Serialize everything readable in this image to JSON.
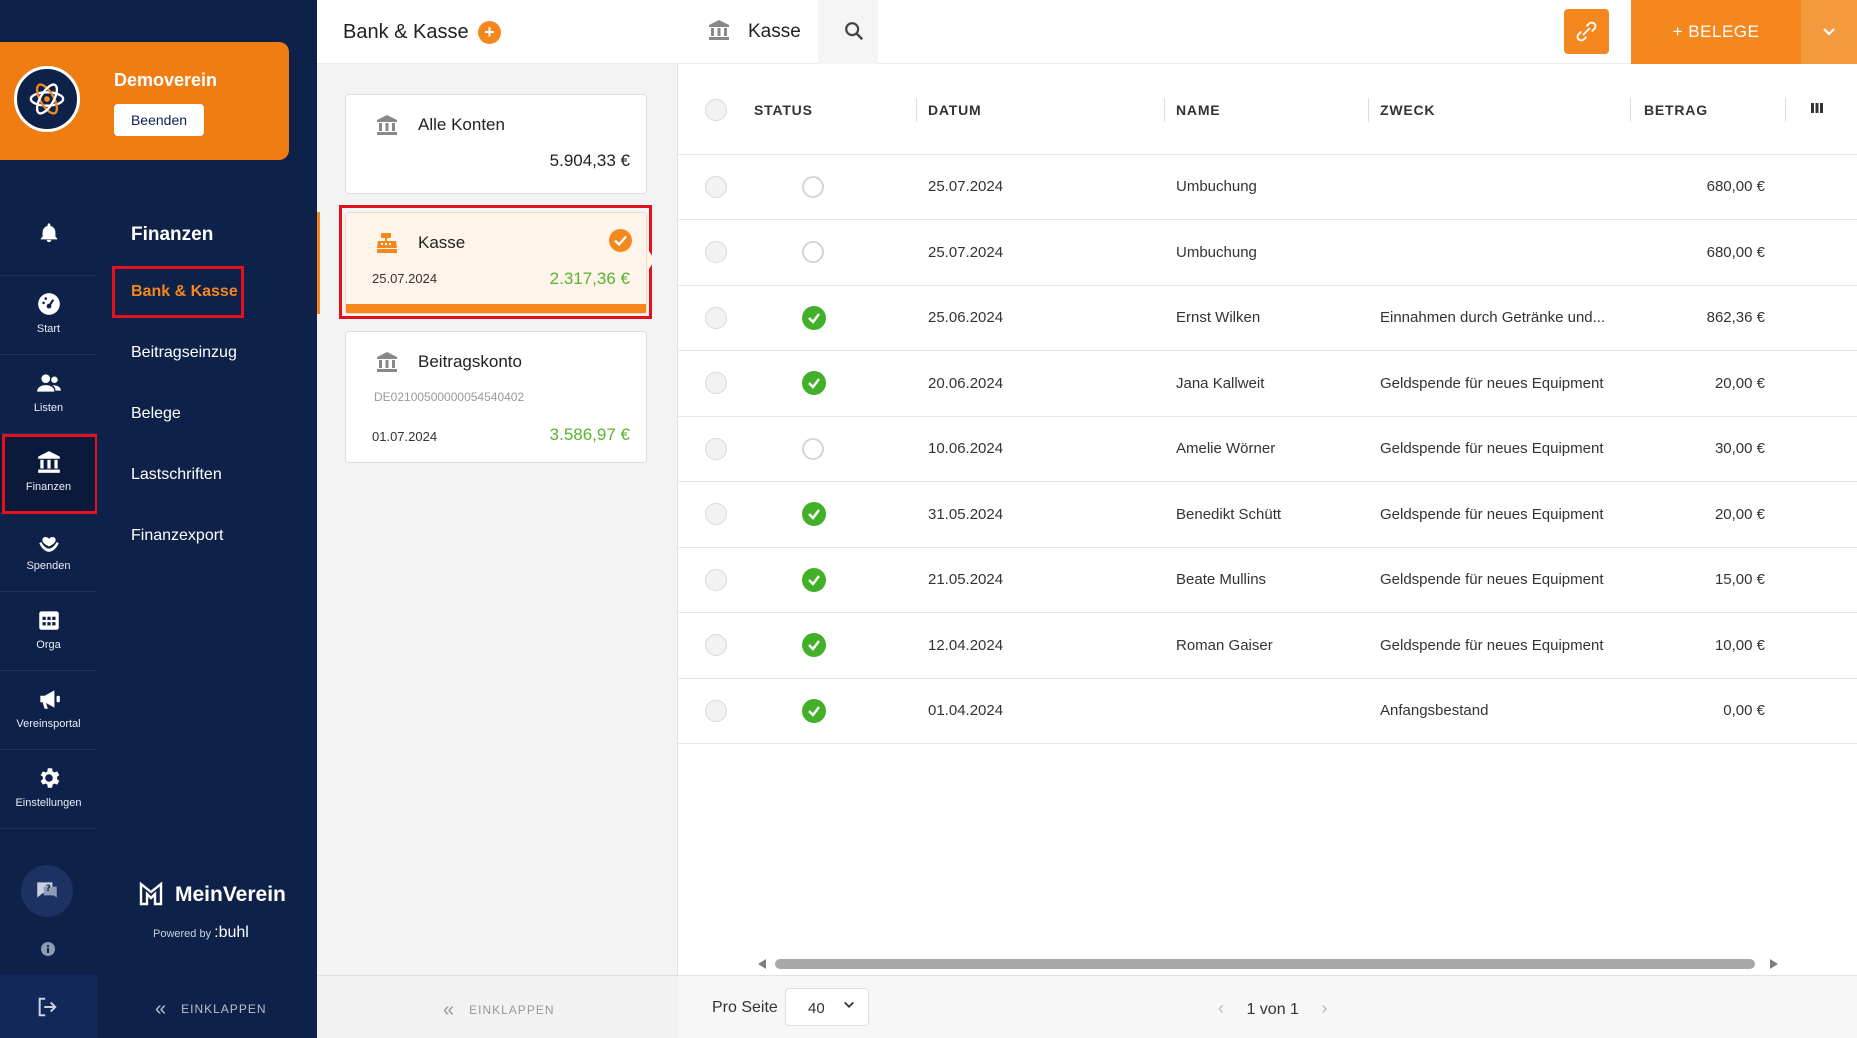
{
  "org": {
    "name": "Demoverein",
    "end_button": "Beenden"
  },
  "rail": {
    "items": [
      {
        "label": "Start",
        "icon": "dashboard-icon"
      },
      {
        "label": "Listen",
        "icon": "users-icon"
      },
      {
        "label": "Finanzen",
        "icon": "bank-icon"
      },
      {
        "label": "Spenden",
        "icon": "donation-icon"
      },
      {
        "label": "Orga",
        "icon": "calendar-icon"
      },
      {
        "label": "Vereinsportal",
        "icon": "megaphone-icon"
      },
      {
        "label": "Einstellungen",
        "icon": "gear-icon"
      }
    ]
  },
  "subnav": {
    "title": "Finanzen",
    "items": [
      {
        "label": "Bank & Kasse",
        "active": true
      },
      {
        "label": "Beitragseinzug"
      },
      {
        "label": "Belege"
      },
      {
        "label": "Lastschriften"
      },
      {
        "label": "Finanzexport"
      }
    ],
    "brand": {
      "name": "MeinVerein",
      "powered": "Powered by",
      "powered_brand": ":buhl"
    },
    "collapse_label": "EINKLAPPEN"
  },
  "accounts": {
    "title": "Bank & Kasse",
    "add_label": "+",
    "cards": [
      {
        "name": "Alle Konten",
        "amount": "5.904,33 €"
      },
      {
        "name": "Kasse",
        "date": "25.07.2024",
        "amount": "2.317,36 €"
      },
      {
        "name": "Beitragskonto",
        "iban": "DE02100500000054540402",
        "date": "01.07.2024",
        "amount": "3.586,97 €"
      }
    ],
    "collapse_label": "EINKLAPPEN"
  },
  "main": {
    "title": "Kasse",
    "belege_button": "+ BELEGE",
    "columns": {
      "status": "STATUS",
      "date": "DATUM",
      "name": "NAME",
      "purpose": "ZWECK",
      "amount": "BETRAG"
    },
    "rows": [
      {
        "status": "open",
        "date": "25.07.2024",
        "name": "Umbuchung",
        "purpose": "",
        "amount": "680,00 €"
      },
      {
        "status": "open",
        "date": "25.07.2024",
        "name": "Umbuchung",
        "purpose": "",
        "amount": "680,00 €"
      },
      {
        "status": "done",
        "date": "25.06.2024",
        "name": "Ernst Wilken",
        "purpose": "Einnahmen durch Getränke und...",
        "amount": "862,36 €"
      },
      {
        "status": "done",
        "date": "20.06.2024",
        "name": "Jana Kallweit",
        "purpose": "Geldspende für neues Equipment",
        "amount": "20,00 €"
      },
      {
        "status": "open",
        "date": "10.06.2024",
        "name": "Amelie Wörner",
        "purpose": "Geldspende für neues Equipment",
        "amount": "30,00 €"
      },
      {
        "status": "done",
        "date": "31.05.2024",
        "name": "Benedikt Schütt",
        "purpose": "Geldspende für neues Equipment",
        "amount": "20,00 €"
      },
      {
        "status": "done",
        "date": "21.05.2024",
        "name": "Beate Mullins",
        "purpose": "Geldspende für neues Equipment",
        "amount": "15,00 €"
      },
      {
        "status": "done",
        "date": "12.04.2024",
        "name": "Roman Gaiser",
        "purpose": "Geldspende für neues Equipment",
        "amount": "10,00 €"
      },
      {
        "status": "done",
        "date": "01.04.2024",
        "name": "",
        "purpose": "Anfangsbestand",
        "amount": "0,00 €"
      }
    ],
    "footer": {
      "per_page_label": "Pro Seite",
      "per_page_value": "40",
      "page_info": "1 von 1"
    }
  },
  "colors": {
    "accent": "#f5871f",
    "navy": "#0e2149",
    "positive": "#58b32d",
    "status_ok": "#43b02a",
    "highlight": "#e3101e"
  }
}
